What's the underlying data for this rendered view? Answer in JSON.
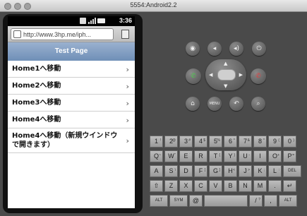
{
  "window": {
    "title": "5554:Android2.2"
  },
  "status_bar": {
    "time": "3:36"
  },
  "browser": {
    "url": "http://www.3hp.me/iph..."
  },
  "page": {
    "title": "Test Page",
    "items": [
      {
        "label": "Home1へ移動"
      },
      {
        "label": "Home2へ移動"
      },
      {
        "label": "Home3へ移動"
      },
      {
        "label": "Home4へ移動"
      },
      {
        "label": "Home4へ移動（新規ウインドウで開きます）"
      }
    ],
    "chevron": "›"
  },
  "controls": {
    "camera": "camera-icon",
    "vol_down": "volume-down-icon",
    "vol_up": "volume-up-icon",
    "power": "power-icon",
    "call": "call-icon",
    "end_call": "end-call-icon",
    "home": "home-icon",
    "menu_label": "MENU",
    "back": "back-icon",
    "search": "search-icon"
  },
  "keyboard": {
    "row1": [
      {
        "k": "1",
        "a": "!"
      },
      {
        "k": "2",
        "a": "@"
      },
      {
        "k": "3",
        "a": "#"
      },
      {
        "k": "4",
        "a": "$"
      },
      {
        "k": "5",
        "a": "%"
      },
      {
        "k": "6",
        "a": "^"
      },
      {
        "k": "7",
        "a": "&"
      },
      {
        "k": "8",
        "a": "*"
      },
      {
        "k": "9",
        "a": "("
      },
      {
        "k": "0",
        "a": ")"
      }
    ],
    "row2": [
      {
        "k": "Q",
        "a": "~"
      },
      {
        "k": "W",
        "a": "\""
      },
      {
        "k": "E",
        "a": "´"
      },
      {
        "k": "R",
        "a": ""
      },
      {
        "k": "T",
        "a": "{"
      },
      {
        "k": "Y",
        "a": "}"
      },
      {
        "k": "U",
        "a": "-"
      },
      {
        "k": "I",
        "a": ""
      },
      {
        "k": "O",
        "a": "+"
      },
      {
        "k": "P",
        "a": "="
      }
    ],
    "row3": [
      {
        "k": "A",
        "a": ""
      },
      {
        "k": "S",
        "a": "\\"
      },
      {
        "k": "D",
        "a": ""
      },
      {
        "k": "F",
        "a": "["
      },
      {
        "k": "G",
        "a": "]"
      },
      {
        "k": "H",
        "a": "<"
      },
      {
        "k": "J",
        "a": ">"
      },
      {
        "k": "K",
        "a": ";"
      },
      {
        "k": "L",
        "a": ":"
      },
      {
        "k": "DEL",
        "a": ""
      }
    ],
    "row4": [
      {
        "k": "⇧",
        "a": ""
      },
      {
        "k": "Z",
        "a": ""
      },
      {
        "k": "X",
        "a": ""
      },
      {
        "k": "C",
        "a": ""
      },
      {
        "k": "V",
        "a": ""
      },
      {
        "k": "B",
        "a": ""
      },
      {
        "k": "N",
        "a": ""
      },
      {
        "k": "M",
        "a": ""
      },
      {
        "k": ".",
        "a": ""
      },
      {
        "k": "↵",
        "a": ""
      }
    ],
    "row5": [
      {
        "k": "ALT",
        "a": ""
      },
      {
        "k": "SYM",
        "a": ""
      },
      {
        "k": "@",
        "a": ""
      },
      {
        "k": "",
        "a": ""
      },
      {
        "k": "/",
        "a": "?"
      },
      {
        "k": ",",
        "a": ""
      },
      {
        "k": "ALT",
        "a": ""
      }
    ]
  }
}
